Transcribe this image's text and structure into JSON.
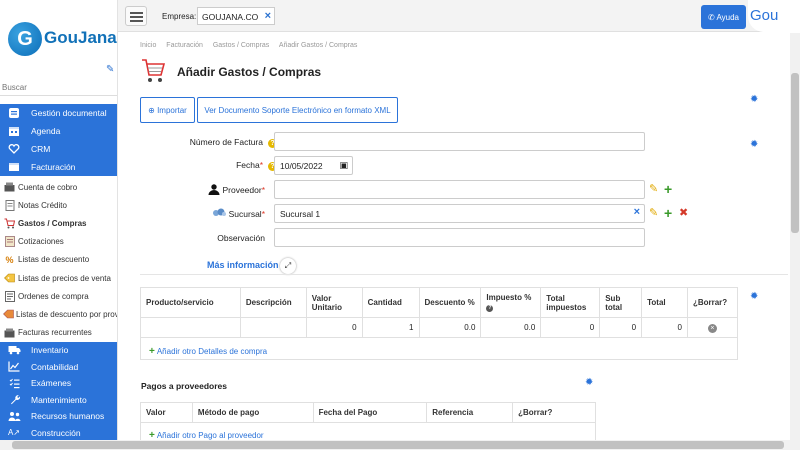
{
  "app": {
    "logo_letter": "G",
    "logo_text": "GouJana"
  },
  "sidebar": {
    "search_placeholder": "Buscar",
    "top_items": [
      {
        "label": "Gestión documental",
        "icon": "document-icon"
      },
      {
        "label": "Agenda",
        "icon": "calendar-icon"
      },
      {
        "label": "CRM",
        "icon": "heart-icon"
      },
      {
        "label": "Facturación",
        "icon": "invoice-icon"
      }
    ],
    "sub_items": [
      {
        "label": "Cuenta de cobro",
        "icon": "register-icon"
      },
      {
        "label": "Notas Crédito",
        "icon": "note-icon"
      },
      {
        "label": "Gastos / Compras",
        "icon": "cart-icon"
      },
      {
        "label": "Cotizaciones",
        "icon": "quote-icon"
      },
      {
        "label": "Listas de descuento",
        "icon": "percent-icon"
      },
      {
        "label": "Listas de precios de venta",
        "icon": "price-tag-icon"
      },
      {
        "label": "Ordenes de compra",
        "icon": "order-icon"
      },
      {
        "label": "Listas de descuento por proveedor",
        "icon": "discount-list-icon"
      },
      {
        "label": "Facturas recurrentes",
        "icon": "recurring-icon"
      }
    ],
    "bottom_items": [
      {
        "label": "Inventario",
        "icon": "truck-icon"
      },
      {
        "label": "Contabilidad",
        "icon": "chart-icon"
      },
      {
        "label": "Exámenes",
        "icon": "checklist-icon"
      },
      {
        "label": "Mantenimiento",
        "icon": "wrench-icon"
      },
      {
        "label": "Recursos humanos",
        "icon": "people-icon"
      },
      {
        "label": "Construcción",
        "icon": "construction-icon"
      }
    ]
  },
  "topbar": {
    "company_label": "Empresa:",
    "company_value": "GOUJANA.CO",
    "help_label": "Ayuda",
    "badge": "Gou"
  },
  "breadcrumb": [
    "Inicio",
    "Facturación",
    "Gastos / Compras",
    "Añadir Gastos / Compras"
  ],
  "page": {
    "title": "Añadir Gastos / Compras",
    "import_label": "Importar",
    "xml_label": "Ver Documento Soporte Electrónico en formato XML"
  },
  "form": {
    "invoice_number": {
      "label": "Número de Factura",
      "value": ""
    },
    "date": {
      "label": "Fecha",
      "value": "10/05/2022"
    },
    "supplier": {
      "label": "Proveedor",
      "value": ""
    },
    "branch": {
      "label": "Sucursal",
      "value": "Sucursal 1"
    },
    "observation": {
      "label": "Observación",
      "value": ""
    },
    "more_info": "Más información"
  },
  "products_table": {
    "headers": [
      "Producto/servicio",
      "Descripción",
      "Valor Unitario",
      "Cantidad",
      "Descuento %",
      "Impuesto %",
      "Total impuestos",
      "Sub total",
      "Total",
      "¿Borrar?"
    ],
    "row": [
      "",
      "",
      "0",
      "1",
      "0.0",
      "0.0",
      "0",
      "0",
      "0"
    ],
    "add_label": "Añadir otro Detalles de compra"
  },
  "payments": {
    "title": "Pagos a proveedores",
    "headers": [
      "Valor",
      "Método de pago",
      "Fecha del Pago",
      "Referencia",
      "¿Borrar?"
    ],
    "add_label": "Añadir otro Pago al proveedor"
  },
  "colors": {
    "primary": "#2b73d9",
    "add_green": "#3a9a2a",
    "delete_red": "#d43a2a",
    "edit_yellow": "#e0a800"
  }
}
